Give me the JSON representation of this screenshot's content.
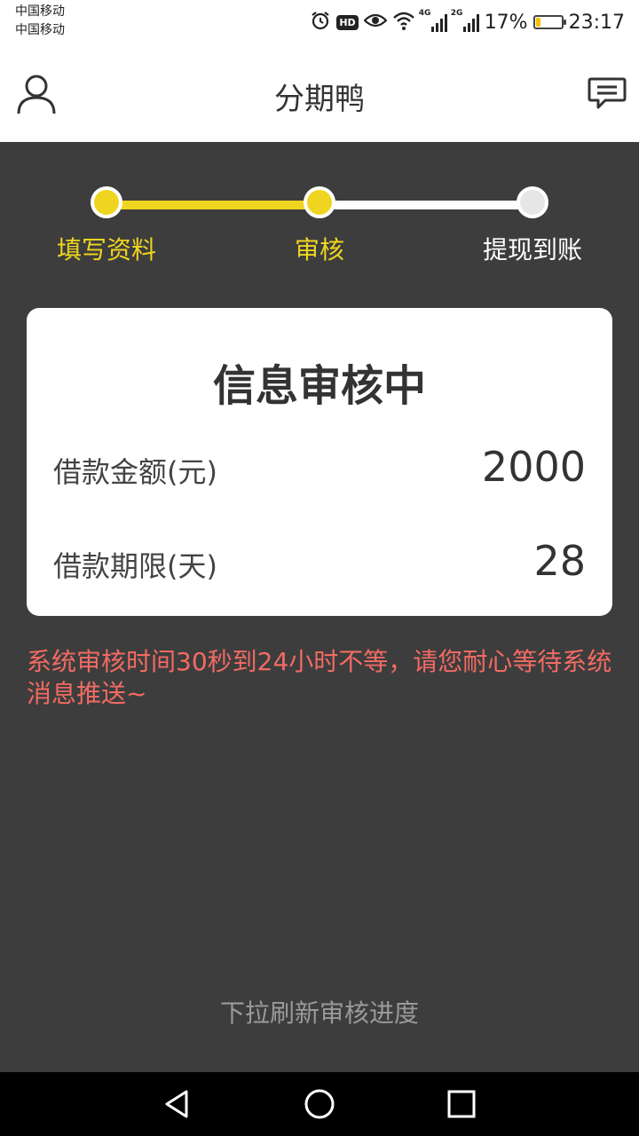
{
  "status_bar": {
    "carrier_1": "中国移动",
    "carrier_2": "中国移动",
    "alarm_icon": "alarm-clock-icon",
    "hd_badge": "HD",
    "eye_icon": "eye-icon",
    "wifi_icon": "wifi-icon",
    "net_1": "4G",
    "net_2": "2G",
    "battery_percent": "17%",
    "battery_level": 0.17,
    "time": "23:17"
  },
  "header": {
    "title": "分期鸭",
    "left_icon": "user-icon",
    "right_icon": "message-icon"
  },
  "progress": {
    "steps": [
      {
        "label": "填写资料",
        "state": "done"
      },
      {
        "label": "审核",
        "state": "current"
      },
      {
        "label": "提现到账",
        "state": "pending"
      }
    ],
    "accent_color": "#f0d520",
    "inactive_color": "#ffffff"
  },
  "card": {
    "title": "信息审核中",
    "rows": [
      {
        "label": "借款金额(元)",
        "value": "2000"
      },
      {
        "label": "借款期限(天)",
        "value": "28"
      }
    ]
  },
  "notice": "系统审核时间30秒到24小时不等，请您耐心等待系统消息推送~",
  "pull_hint": "下拉刷新审核进度",
  "nav_bar": {
    "back_icon": "back-triangle-icon",
    "home_icon": "home-circle-icon",
    "recents_icon": "recents-square-icon"
  }
}
